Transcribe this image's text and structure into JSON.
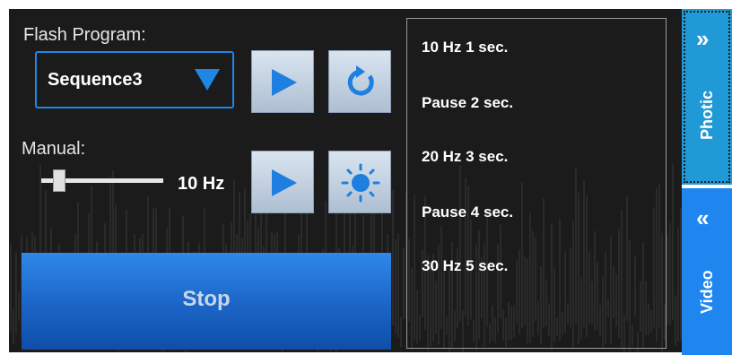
{
  "flash": {
    "label": "Flash Program:",
    "selected_sequence": "Sequence3"
  },
  "manual": {
    "label": "Manual:",
    "frequency": "10 Hz",
    "slider_level": 0.15
  },
  "stop_label": "Stop",
  "program_steps": [
    "10 Hz 1 sec.",
    "Pause 2 sec.",
    "20 Hz 3 sec.",
    "Pause 4 sec.",
    "30 Hz 5 sec."
  ],
  "tabs": {
    "photic": "Photic",
    "video": "Video",
    "photic_chevron": "»",
    "video_chevron": "«"
  },
  "icons": {
    "dropdown": "caret-down-icon",
    "play": "play-icon",
    "reset": "refresh-icon",
    "light": "sun-icon"
  },
  "colors": {
    "accent": "#1f86e6",
    "play_icon": "#1e7fe0",
    "stop_button": "#1b64c6",
    "photic_tab": "#1f9ad6",
    "video_tab": "#1f86f0",
    "panel_bg": "#1b1b1b"
  }
}
